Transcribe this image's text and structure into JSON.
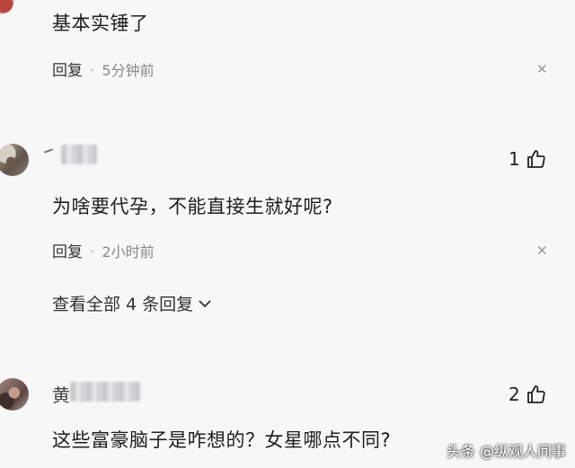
{
  "comments": [
    {
      "text": "基本实锤了",
      "reply_label": "回复",
      "time": "5分钟前"
    },
    {
      "text": "为啥要代孕，不能直接生就好呢?",
      "reply_label": "回复",
      "time": "2小时前",
      "likes": "1"
    },
    {
      "name_visible": "黄",
      "text": "这些富豪脑子是咋想的？女星哪点不同?",
      "likes": "2"
    }
  ],
  "view_all_label": "查看全部 4 条回复",
  "watermark": "头条 @纵观人间事",
  "icons": {
    "like": "thumbs-up-icon",
    "close": "close-icon",
    "expand": "chevron-down-icon"
  },
  "colors": {
    "background": "#f7f7f8",
    "text": "#1e1e1e",
    "muted": "#888888"
  }
}
